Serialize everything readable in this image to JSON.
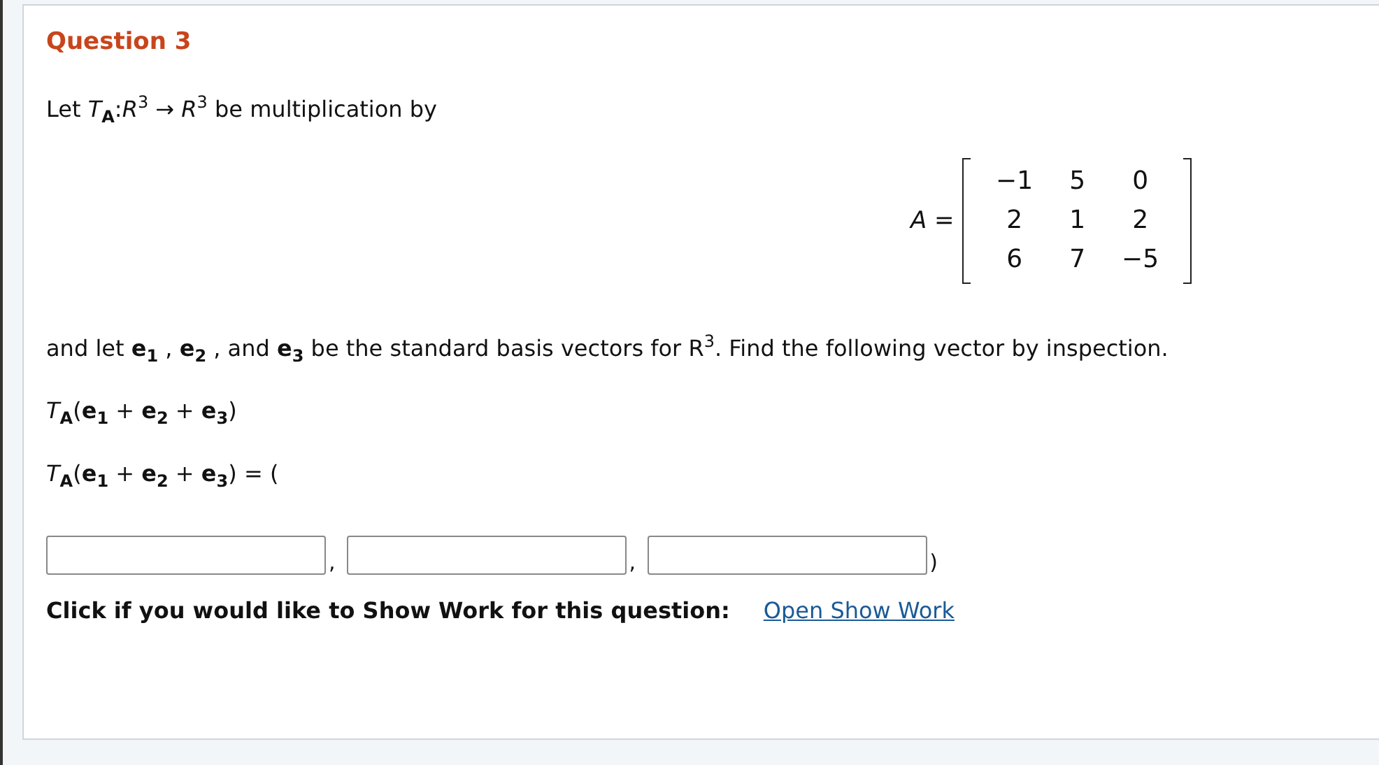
{
  "question": {
    "title": "Question 3",
    "intro": "Let *T*$_{A}$:*R*$^{3}$ → *R*$^{3}$ be multiplication by",
    "matrix": {
      "label": "*A* =",
      "rows": [
        [
          "−1",
          "5",
          "0"
        ],
        [
          "2",
          "1",
          "2"
        ],
        [
          "6",
          "7",
          "−5"
        ]
      ]
    },
    "statement": "and let **e**$_{1}$ , **e**$_{2}$ , and **e**$_{3}$ be the standard basis vectors for R$^{3}$. Find the following vector by inspection.",
    "expression": "*T*$_{A}$(**e**$_{1}$ + **e**$_{2}$ + **e**$_{3}$)",
    "answer_prompt": "*T*$_{A}$(**e**$_{1}$ + **e**$_{2}$ + **e**$_{3}$) = (",
    "answer_fields": [
      {
        "after": ","
      },
      {
        "after": ","
      },
      {
        "after": ")"
      }
    ],
    "show_work": {
      "label": "Click if you would like to Show Work for this question:",
      "link": "Open Show Work"
    }
  }
}
